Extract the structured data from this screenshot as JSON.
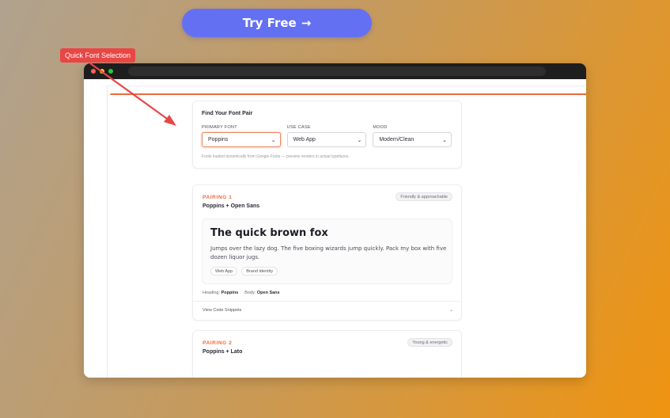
{
  "cta": {
    "label": "Try Free",
    "arrow": "→"
  },
  "annotation": {
    "label": "Quick Font Selection",
    "color": "#e94646"
  },
  "colors": {
    "accent": "#ec6a3e",
    "cta": "#6470f2"
  },
  "finder": {
    "title": "Find Your Font Pair",
    "fields": [
      {
        "label": "PRIMARY FONT",
        "value": "Poppins"
      },
      {
        "label": "USE CASE",
        "value": "Web App"
      },
      {
        "label": "MOOD",
        "value": "Modern/Clean"
      }
    ],
    "note": "Fonts loaded dynamically from Google Fonts — preview renders in actual typefaces."
  },
  "pairings": [
    {
      "label": "PAIRING 1",
      "fonts": "Poppins + Open Sans",
      "badge": "Friendly & approachable",
      "preview_heading": "The quick brown fox",
      "preview_body": "Jumps over the lazy dog. The five boxing wizards jump quickly. Pack my box with five dozen liquor jugs.",
      "tags": [
        "Web App",
        "Brand Identity"
      ],
      "heading_label": "Heading:",
      "heading_font": "Poppins",
      "body_label": "Body:",
      "body_font": "Open Sans",
      "snippets_label": "View Code Snippets"
    },
    {
      "label": "PAIRING 2",
      "fonts": "Poppins + Lato",
      "badge": "Young & energetic"
    }
  ]
}
